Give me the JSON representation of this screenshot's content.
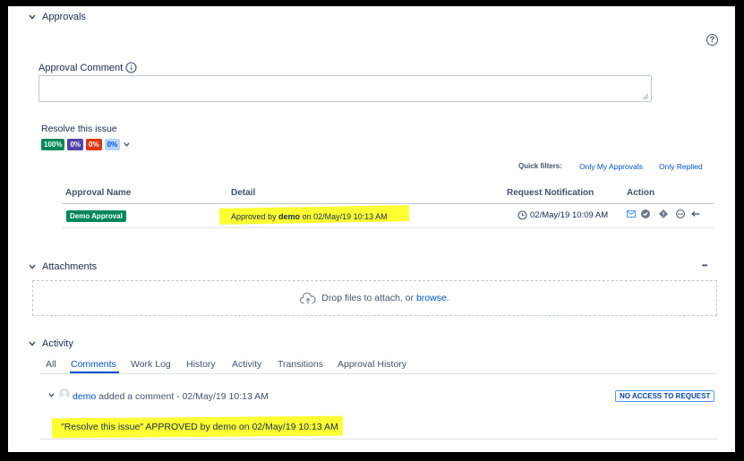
{
  "approvals": {
    "section_title": "Approvals",
    "help_icon": "?",
    "comment_label": "Approval Comment",
    "resolve_title": "Resolve this issue",
    "progress": [
      {
        "label": "100%",
        "color": "#00875a"
      },
      {
        "label": "0%",
        "color": "#5243aa"
      },
      {
        "label": "0%",
        "color": "#de350b"
      },
      {
        "label": "0%",
        "color": "#b3d4ff",
        "text_color": "#0052cc"
      }
    ],
    "quick_filters_label": "Quick filters:",
    "filters": [
      "Only My Approvals",
      "Only Replied"
    ],
    "table": {
      "headers": [
        "Approval Name",
        "Detail",
        "Request Notification",
        "Action"
      ],
      "row": {
        "name": "Demo Approval",
        "detail_prefix": "Approved by ",
        "detail_user": "demo",
        "detail_suffix": " on 02/May/19 10:13 AM",
        "notification": "02/May/19 10:09 AM"
      }
    }
  },
  "attachments": {
    "section_title": "Attachments",
    "more": "•••",
    "drop_text": "Drop files to attach, or ",
    "browse": "browse."
  },
  "activity": {
    "section_title": "Activity",
    "tabs": [
      "All",
      "Comments",
      "Work Log",
      "History",
      "Activity",
      "Transitions",
      "Approval History"
    ],
    "active_tab": "Comments",
    "comment": {
      "user": "demo",
      "meta": " added a comment - 02/May/19 10:13 AM",
      "badge": "NO ACCESS TO REQUEST",
      "body": "\"Resolve this issue\" APPROVED by demo on 02/May/19 10:13 AM"
    }
  },
  "colors": {
    "highlight": "#ffff33",
    "link": "#0052cc",
    "text": "#172b4d"
  }
}
